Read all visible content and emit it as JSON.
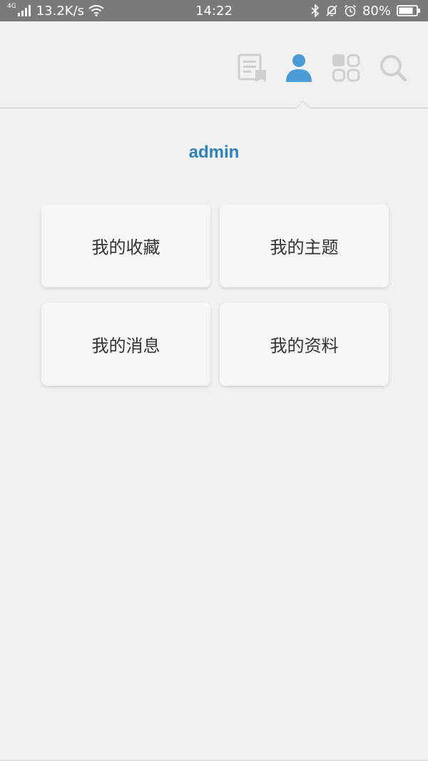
{
  "status_bar": {
    "network_type": "4G",
    "speed": "13.2K/s",
    "time": "14:22",
    "battery": "80%"
  },
  "nav": {
    "icons": [
      "articles-bookmark-icon",
      "user-profile-icon",
      "apps-grid-icon",
      "search-icon"
    ],
    "active": "user-profile-icon",
    "active_color": "#4a9bd6",
    "inactive_color": "#cfcfcf"
  },
  "profile": {
    "username": "admin",
    "username_color": "#2f82b8"
  },
  "menu": {
    "favorites": "我的收藏",
    "topics": "我的主题",
    "messages": "我的消息",
    "profile_info": "我的资料"
  }
}
